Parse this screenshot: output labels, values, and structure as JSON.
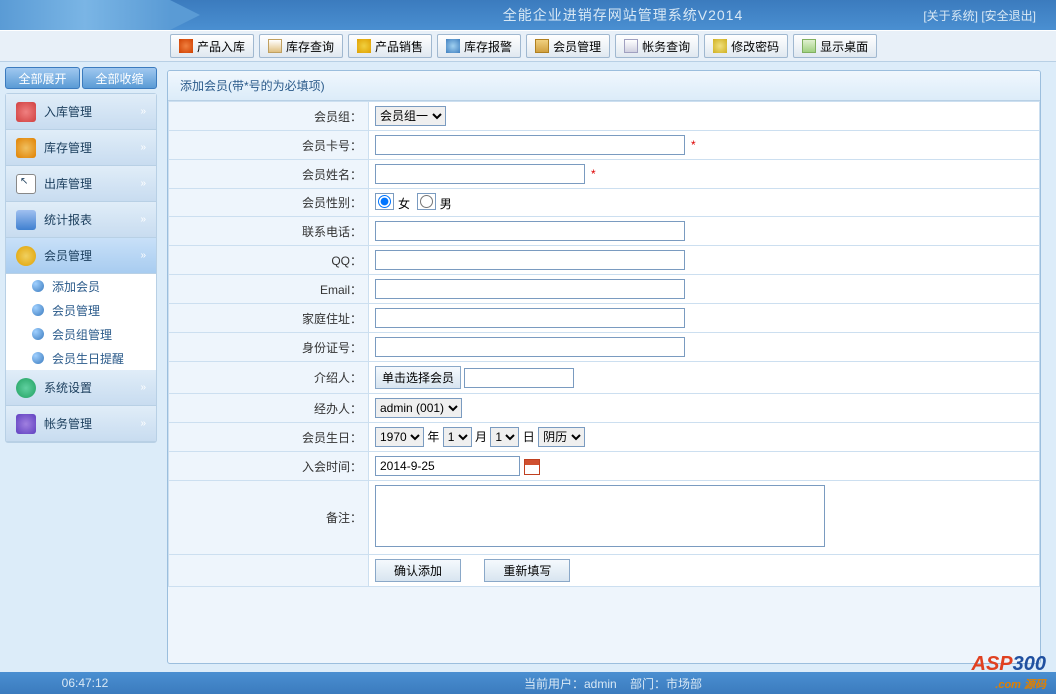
{
  "header": {
    "title": "全能企业进销存网站管理系统V2014",
    "link_about": "[关于系统]",
    "link_exit": "[安全退出]"
  },
  "toolbar": [
    {
      "label": "产品入库",
      "icon": "home"
    },
    {
      "label": "库存查询",
      "icon": "doc"
    },
    {
      "label": "产品销售",
      "icon": "tag"
    },
    {
      "label": "库存报警",
      "icon": "alert"
    },
    {
      "label": "会员管理",
      "icon": "user"
    },
    {
      "label": "帐务查询",
      "icon": "book"
    },
    {
      "label": "修改密码",
      "icon": "key"
    },
    {
      "label": "显示桌面",
      "icon": "desktop"
    }
  ],
  "sidebar": {
    "expand_all": "全部展开",
    "collapse_all": "全部收缩",
    "items": [
      {
        "label": "入库管理",
        "color": "#D04040"
      },
      {
        "label": "库存管理",
        "color": "#E08000"
      },
      {
        "label": "出库管理",
        "color": "#F0D000"
      },
      {
        "label": "统计报表",
        "color": "#4080D0"
      }
    ],
    "member": {
      "label": "会员管理",
      "subs": [
        "添加会员",
        "会员管理",
        "会员组管理",
        "会员生日提醒"
      ]
    },
    "tail": [
      {
        "label": "系统设置",
        "color": "#20A060"
      },
      {
        "label": "帐务管理",
        "color": "#6040C0"
      }
    ]
  },
  "form": {
    "title": "添加会员(带*号的为必填项)",
    "labels": {
      "group": "会员组：",
      "card": "会员卡号：",
      "name": "会员姓名：",
      "gender": "会员性别：",
      "phone": "联系电话：",
      "qq": "QQ：",
      "email": "Email：",
      "addr": "家庭住址：",
      "idcard": "身份证号：",
      "referrer": "介绍人：",
      "operator": "经办人：",
      "birthday": "会员生日：",
      "joindate": "入会时间：",
      "remark": "备注："
    },
    "group_option": "会员组一",
    "gender_female": "女",
    "gender_male": "男",
    "referrer_btn": "单击选择会员",
    "operator_option": "admin (001)",
    "bd_year": "1970",
    "bd_year_lbl": "年",
    "bd_month": "1",
    "bd_month_lbl": "月",
    "bd_day": "1",
    "bd_day_lbl": "日",
    "calendar_type": "阴历",
    "joindate_val": "2014-9-25",
    "submit": "确认添加",
    "reset": "重新填写"
  },
  "footer": {
    "time": "06:47:12",
    "user_label": "当前用户：",
    "user": "admin",
    "dept_label": "部门：",
    "dept": "市场部"
  }
}
